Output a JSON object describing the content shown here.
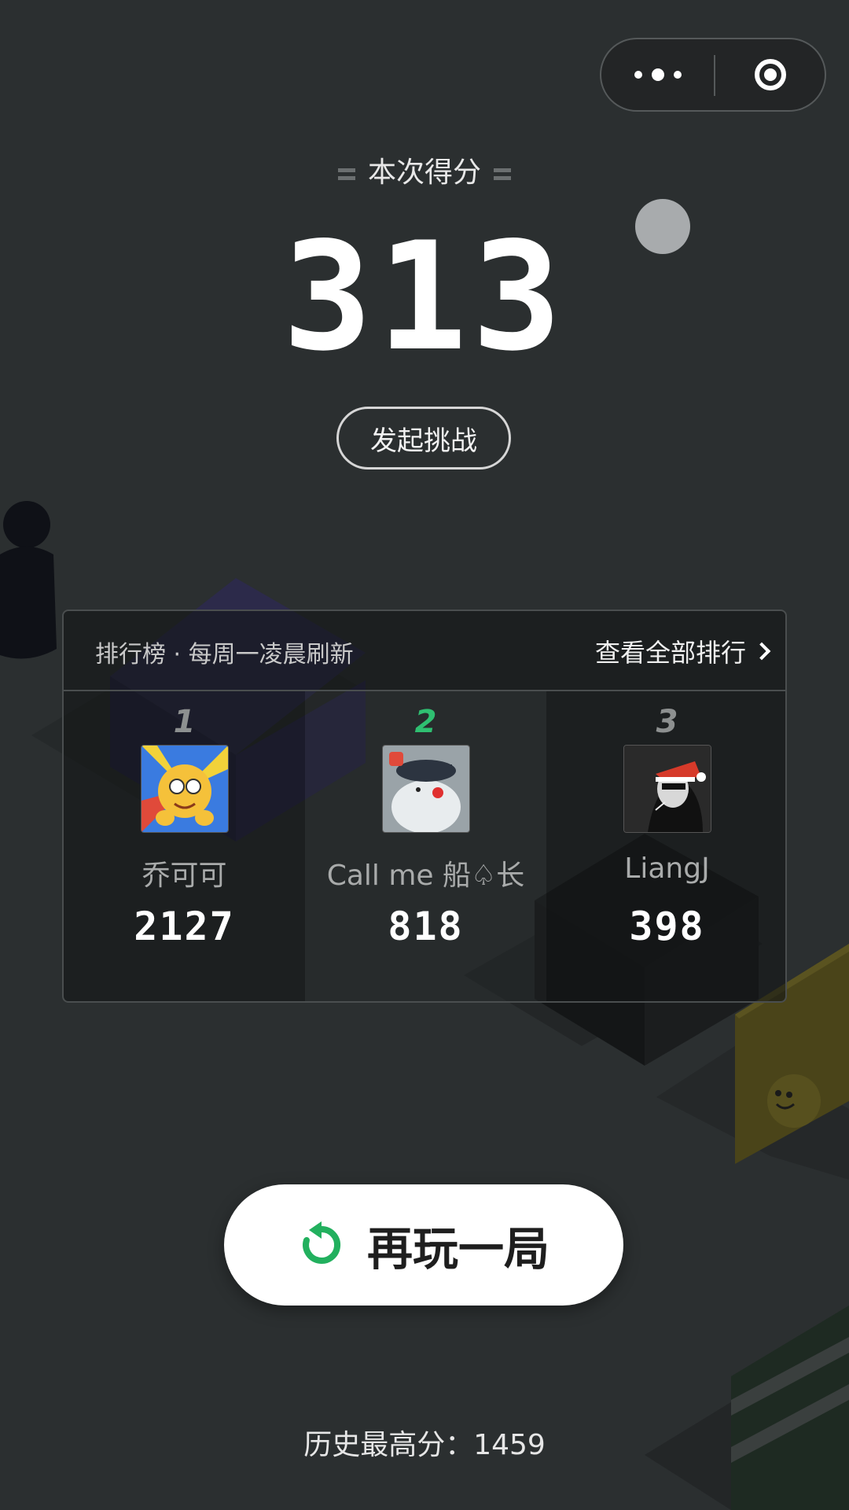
{
  "capsule": {
    "more_icon": "more-dots-icon",
    "close_icon": "target-circle-icon"
  },
  "score_section": {
    "label": "本次得分",
    "score": "313"
  },
  "challenge_button": {
    "label": "发起挑战"
  },
  "leaderboard": {
    "title": "排行榜 · 每周一凌晨刷新",
    "view_all": "查看全部排行",
    "entries": [
      {
        "rank": "1",
        "name": "乔可可",
        "score": "2127",
        "avatar": "avatar-cartoon-boy"
      },
      {
        "rank": "2",
        "name": "Call me 船♤长",
        "score": "818",
        "avatar": "avatar-seal-captain"
      },
      {
        "rank": "3",
        "name": "LiangJ",
        "score": "398",
        "avatar": "avatar-santa-hat-person"
      }
    ]
  },
  "replay_button": {
    "label": "再玩一局",
    "icon": "refresh-icon"
  },
  "history": {
    "text": "历史最高分：1459"
  },
  "colors": {
    "accent_green": "#2fbf71",
    "background": "#2b2f30"
  }
}
